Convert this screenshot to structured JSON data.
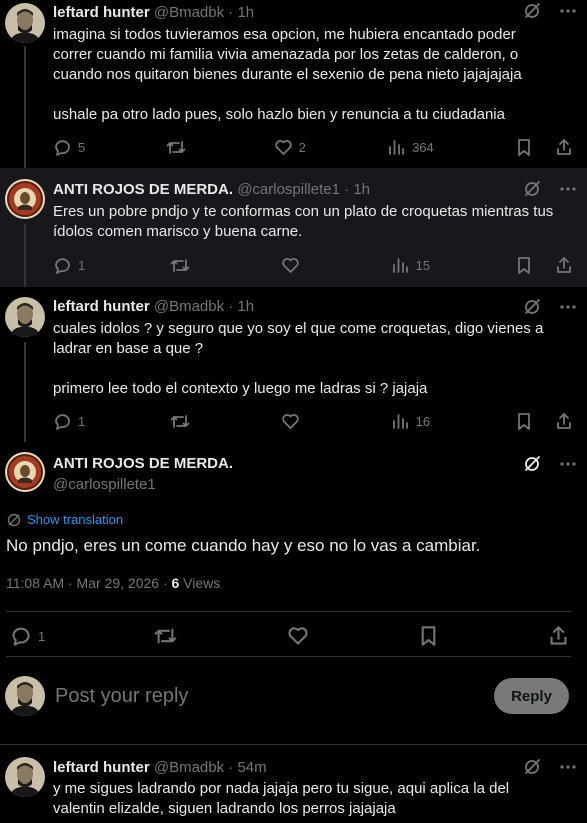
{
  "tweets": [
    {
      "name": "leftard hunter",
      "handle": "@Bmadbk",
      "sep": " · ",
      "time": "1h",
      "lines": [
        "imagina si todos tuvieramos esa opcion, me hubiera encantado poder",
        "correr cuando mi familia vivia amenazada por los zetas de calderon, o",
        "cuando nos quitaron bienes durante el sexenio de pena nieto jajajajaja",
        "",
        "ushale pa otro lado pues, solo hazlo bien y renuncia a tu ciudadania"
      ],
      "replies": "5",
      "retweets": "",
      "likes": "2",
      "views": "364"
    },
    {
      "name": "ANTI ROJOS DE MERDA.",
      "handle": "@carlospillete1",
      "sep": " · ",
      "time": "1h",
      "lines": [
        "Eres un pobre pndjo y te conformas con un plato de croquetas mientras tus",
        "ídolos comen marisco  y buena carne."
      ],
      "replies": "1",
      "retweets": "",
      "likes": "",
      "views": "15"
    },
    {
      "name": "leftard hunter",
      "handle": "@Bmadbk",
      "sep": " · ",
      "time": "1h",
      "lines": [
        "cuales idolos ? y seguro que yo soy el que come croquetas, digo vienes a",
        "ladrar en base a que ?",
        "",
        "primero lee todo el contexto y luego me ladras si ? jajaja"
      ],
      "replies": "1",
      "retweets": "",
      "likes": "",
      "views": "16"
    }
  ],
  "main": {
    "name": "ANTI ROJOS DE MERDA.",
    "handle": "@carlospillete1",
    "show_translation": "Show translation",
    "text": "No pndjo, eres un come cuando hay y eso no lo vas a cambiar.",
    "timestamp": "11:08 AM · Mar 29, 2026 · ",
    "views_count": "6",
    "views_label": " Views",
    "replies": "1"
  },
  "composer": {
    "placeholder": "Post your reply",
    "reply_button": "Reply"
  },
  "last": {
    "name": "leftard hunter",
    "handle": "@Bmadbk",
    "sep": " · ",
    "time": "54m",
    "lines": [
      "y me sigues ladrando por nada jajaja pero tu sigue, aqui aplica la del",
      "valentin elizalde, siguen ladrando los perros jajajaja"
    ]
  },
  "colors": {
    "background": "#000000",
    "highlight": "#16181c",
    "text": "#e7e9ea",
    "muted": "#71767b",
    "link": "#1d9bf0",
    "reply_button": "#787a7a"
  }
}
